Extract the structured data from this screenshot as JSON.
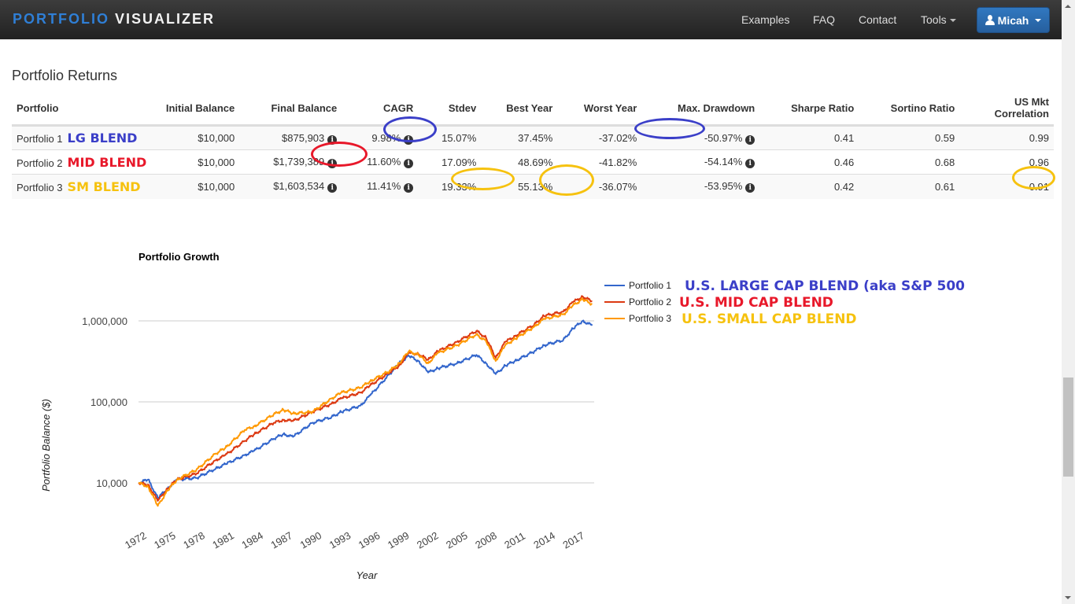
{
  "navbar": {
    "brand_part1": "PORTFOLIO",
    "brand_part2": "VISUALIZER",
    "links": [
      "Examples",
      "FAQ",
      "Contact",
      "Tools"
    ],
    "user_label": "Micah"
  },
  "returns": {
    "title": "Portfolio Returns",
    "columns": [
      "Portfolio",
      "Initial Balance",
      "Final Balance",
      "CAGR",
      "Stdev",
      "Best Year",
      "Worst Year",
      "Max. Drawdown",
      "Sharpe Ratio",
      "Sortino Ratio",
      "US Mkt Correlation"
    ],
    "rows": [
      {
        "name": "Portfolio 1",
        "tag": "LG BLEND",
        "tag_color": "#3b3fc8",
        "initial": "$10,000",
        "final": "$875,903",
        "cagr": "9.98%",
        "stdev": "15.07%",
        "best": "37.45%",
        "worst": "-37.02%",
        "drawdown": "-50.97%",
        "sharpe": "0.41",
        "sortino": "0.59",
        "corr": "0.99"
      },
      {
        "name": "Portfolio 2",
        "tag": "MID BLEND",
        "tag_color": "#e8182a",
        "initial": "$10,000",
        "final": "$1,739,389",
        "cagr": "11.60%",
        "stdev": "17.09%",
        "best": "48.69%",
        "worst": "-41.82%",
        "drawdown": "-54.14%",
        "sharpe": "0.46",
        "sortino": "0.68",
        "corr": "0.96"
      },
      {
        "name": "Portfolio 3",
        "tag": "SM BLEND",
        "tag_color": "#f6c20f",
        "initial": "$10,000",
        "final": "$1,603,534",
        "cagr": "11.41%",
        "stdev": "19.33%",
        "best": "55.13%",
        "worst": "-36.07%",
        "drawdown": "-53.95%",
        "sharpe": "0.42",
        "sortino": "0.61",
        "corr": "0.91"
      }
    ],
    "info_glyph": "i",
    "highlight_colors": {
      "blue": "#3b3fc8",
      "red": "#e8182a",
      "yellow": "#f6c20f"
    }
  },
  "chart_data": {
    "type": "line",
    "title": "Portfolio Growth",
    "xlabel": "Year",
    "ylabel": "Portfolio Balance ($)",
    "yscale": "log",
    "ylim": [
      5000,
      2500000
    ],
    "xlim": [
      1972,
      2019.2
    ],
    "yticks": [
      10000,
      100000,
      1000000
    ],
    "ytick_labels": [
      "10,000",
      "100,000",
      "1,000,000"
    ],
    "xtick_labels": [
      "1972",
      "1975",
      "1978",
      "1981",
      "1984",
      "1987",
      "1990",
      "1993",
      "1996",
      "1999",
      "2002",
      "2005",
      "2008",
      "2011",
      "2014",
      "2017"
    ],
    "grid": true,
    "legend_position": "right",
    "x": [
      1972,
      1973,
      1974,
      1975,
      1976,
      1978,
      1980,
      1981,
      1983,
      1984,
      1986,
      1987,
      1988,
      1990,
      1992,
      1993,
      1995,
      1996,
      1998,
      1999,
      2000,
      2001,
      2002,
      2003,
      2005,
      2007,
      2008,
      2009,
      2010,
      2011,
      2013,
      2014,
      2016,
      2017,
      2018,
      2019
    ],
    "series": [
      {
        "name": "Portfolio 1",
        "annotation": "U.S. LARGE CAP BLEND (aka S&P 500",
        "color": "#3366cc",
        "annotation_color": "#3b3fc8",
        "values": [
          10000,
          11000,
          6500,
          8500,
          11000,
          11500,
          15000,
          17000,
          22000,
          25000,
          35000,
          40000,
          37000,
          55000,
          65000,
          75000,
          90000,
          120000,
          220000,
          300000,
          370000,
          320000,
          230000,
          260000,
          300000,
          380000,
          300000,
          220000,
          280000,
          320000,
          420000,
          500000,
          580000,
          800000,
          1000000,
          876000
        ]
      },
      {
        "name": "Portfolio 2",
        "annotation": "U.S. MID CAP BLEND",
        "color": "#dc3912",
        "annotation_color": "#e8182a",
        "values": [
          10000,
          9500,
          6000,
          8500,
          11000,
          13000,
          19000,
          22000,
          33000,
          40000,
          55000,
          60000,
          58000,
          75000,
          95000,
          110000,
          130000,
          160000,
          230000,
          280000,
          400000,
          390000,
          330000,
          420000,
          550000,
          750000,
          620000,
          350000,
          550000,
          650000,
          900000,
          1150000,
          1300000,
          1700000,
          2000000,
          1739000
        ]
      },
      {
        "name": "Portfolio 3",
        "annotation": "U.S. SMALL CAP BLEND",
        "color": "#ff9900",
        "annotation_color": "#f6c20f",
        "values": [
          10000,
          9000,
          5200,
          8000,
          11000,
          14500,
          23000,
          27000,
          45000,
          50000,
          70000,
          80000,
          72000,
          75000,
          110000,
          130000,
          150000,
          180000,
          240000,
          300000,
          420000,
          380000,
          300000,
          400000,
          500000,
          680000,
          560000,
          320000,
          500000,
          600000,
          850000,
          1050000,
          1200000,
          1550000,
          1850000,
          1603000
        ]
      }
    ]
  }
}
